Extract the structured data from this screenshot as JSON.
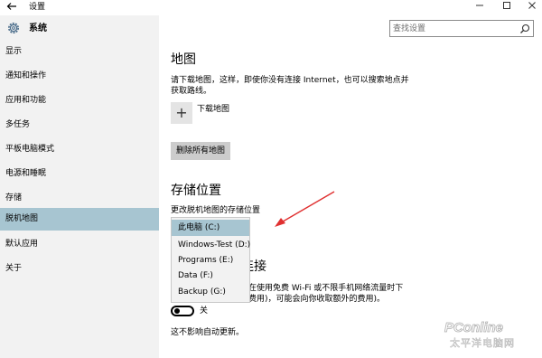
{
  "window": {
    "title": "设置",
    "back_icon": "back-arrow-icon",
    "min_icon": "minimize-icon",
    "max_icon": "maximize-icon",
    "close_icon": "close-icon"
  },
  "search": {
    "placeholder": "查找设置"
  },
  "sidebar": {
    "header": "系统",
    "header_icon": "gear-icon",
    "items": [
      {
        "label": "显示",
        "active": false
      },
      {
        "label": "通知和操作",
        "active": false
      },
      {
        "label": "应用和功能",
        "active": false
      },
      {
        "label": "多任务",
        "active": false
      },
      {
        "label": "平板电脑模式",
        "active": false
      },
      {
        "label": "电源和睡眠",
        "active": false
      },
      {
        "label": "存储",
        "active": false
      },
      {
        "label": "脱机地图",
        "active": true
      },
      {
        "label": "默认应用",
        "active": false
      },
      {
        "label": "关于",
        "active": false
      }
    ]
  },
  "main": {
    "maps_title": "地图",
    "maps_desc_line1": "请下载地图，这样，即使你没有连接 Internet，也可以搜索地点并",
    "maps_desc_line2": "获取路线。",
    "download_label": "下载地图",
    "delete_all_label": "删除所有地图",
    "storage_title": "存储位置",
    "storage_desc": "更改脱机地图的存储位置",
    "storage_options": [
      {
        "label": "此电脑 (C:)",
        "selected": true
      },
      {
        "label": "Windows-Test (D:)",
        "selected": false
      },
      {
        "label": "Programs (E:)",
        "selected": false
      },
      {
        "label": "Data (F:)",
        "selected": false
      },
      {
        "label": "Backup (G:)",
        "selected": false
      }
    ],
    "metered_title_partial": "连接",
    "metered_desc_line1_partial": "在使用免费 Wi-Fi 或不限手机网络流量时下",
    "metered_desc_line2_partial": "费用)，可能会向你收取额外的费用)。",
    "toggle_label": "关",
    "toggle_on": false,
    "auto_update_desc": "这不影响自动更新。"
  },
  "colors": {
    "sidebar_bg": "#f2f2f2",
    "active_bg": "#a7c5d1",
    "annotation_arrow": "#e03030"
  },
  "watermark": {
    "brand": "PConline",
    "brand_sub": "太平洋电脑网"
  }
}
